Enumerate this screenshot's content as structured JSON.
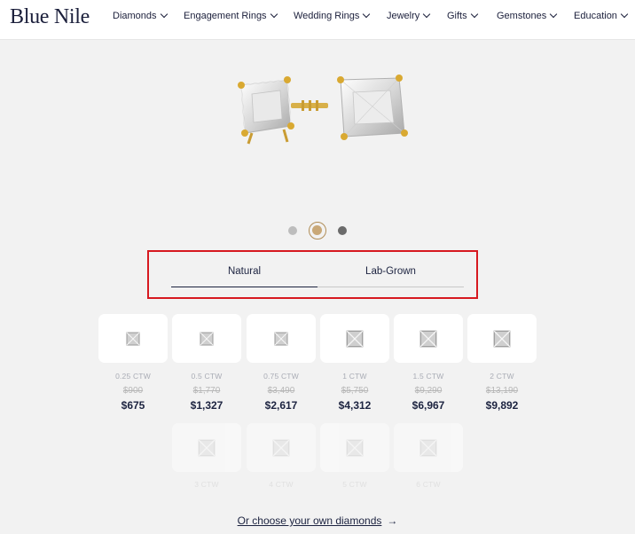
{
  "header": {
    "logo": "Blue Nile",
    "nav": [
      {
        "label": "Diamonds"
      },
      {
        "label": "Engagement Rings"
      },
      {
        "label": "Wedding Rings"
      },
      {
        "label": "Jewelry"
      },
      {
        "label": "Gifts"
      },
      {
        "label": "Gemstones"
      },
      {
        "label": "Education"
      }
    ]
  },
  "tabs": {
    "natural": "Natural",
    "lab": "Lab-Grown",
    "active": "Natural"
  },
  "options": [
    {
      "ctw": "0.25 CTW",
      "original": "$900",
      "price": "$675"
    },
    {
      "ctw": "0.5 CTW",
      "original": "$1,770",
      "price": "$1,327"
    },
    {
      "ctw": "0.75 CTW",
      "original": "$3,490",
      "price": "$2,617"
    },
    {
      "ctw": "1 CTW",
      "original": "$5,750",
      "price": "$4,312"
    },
    {
      "ctw": "1.5 CTW",
      "original": "$9,290",
      "price": "$6,967"
    },
    {
      "ctw": "2 CTW",
      "original": "$13,190",
      "price": "$9,892"
    },
    {
      "ctw": "3 CTW"
    },
    {
      "ctw": "4 CTW"
    },
    {
      "ctw": "5 CTW"
    },
    {
      "ctw": "6 CTW"
    }
  ],
  "carousel": {
    "active_dot": 2
  },
  "cta": {
    "label": "Or choose your own diamonds",
    "arrow": "→"
  }
}
